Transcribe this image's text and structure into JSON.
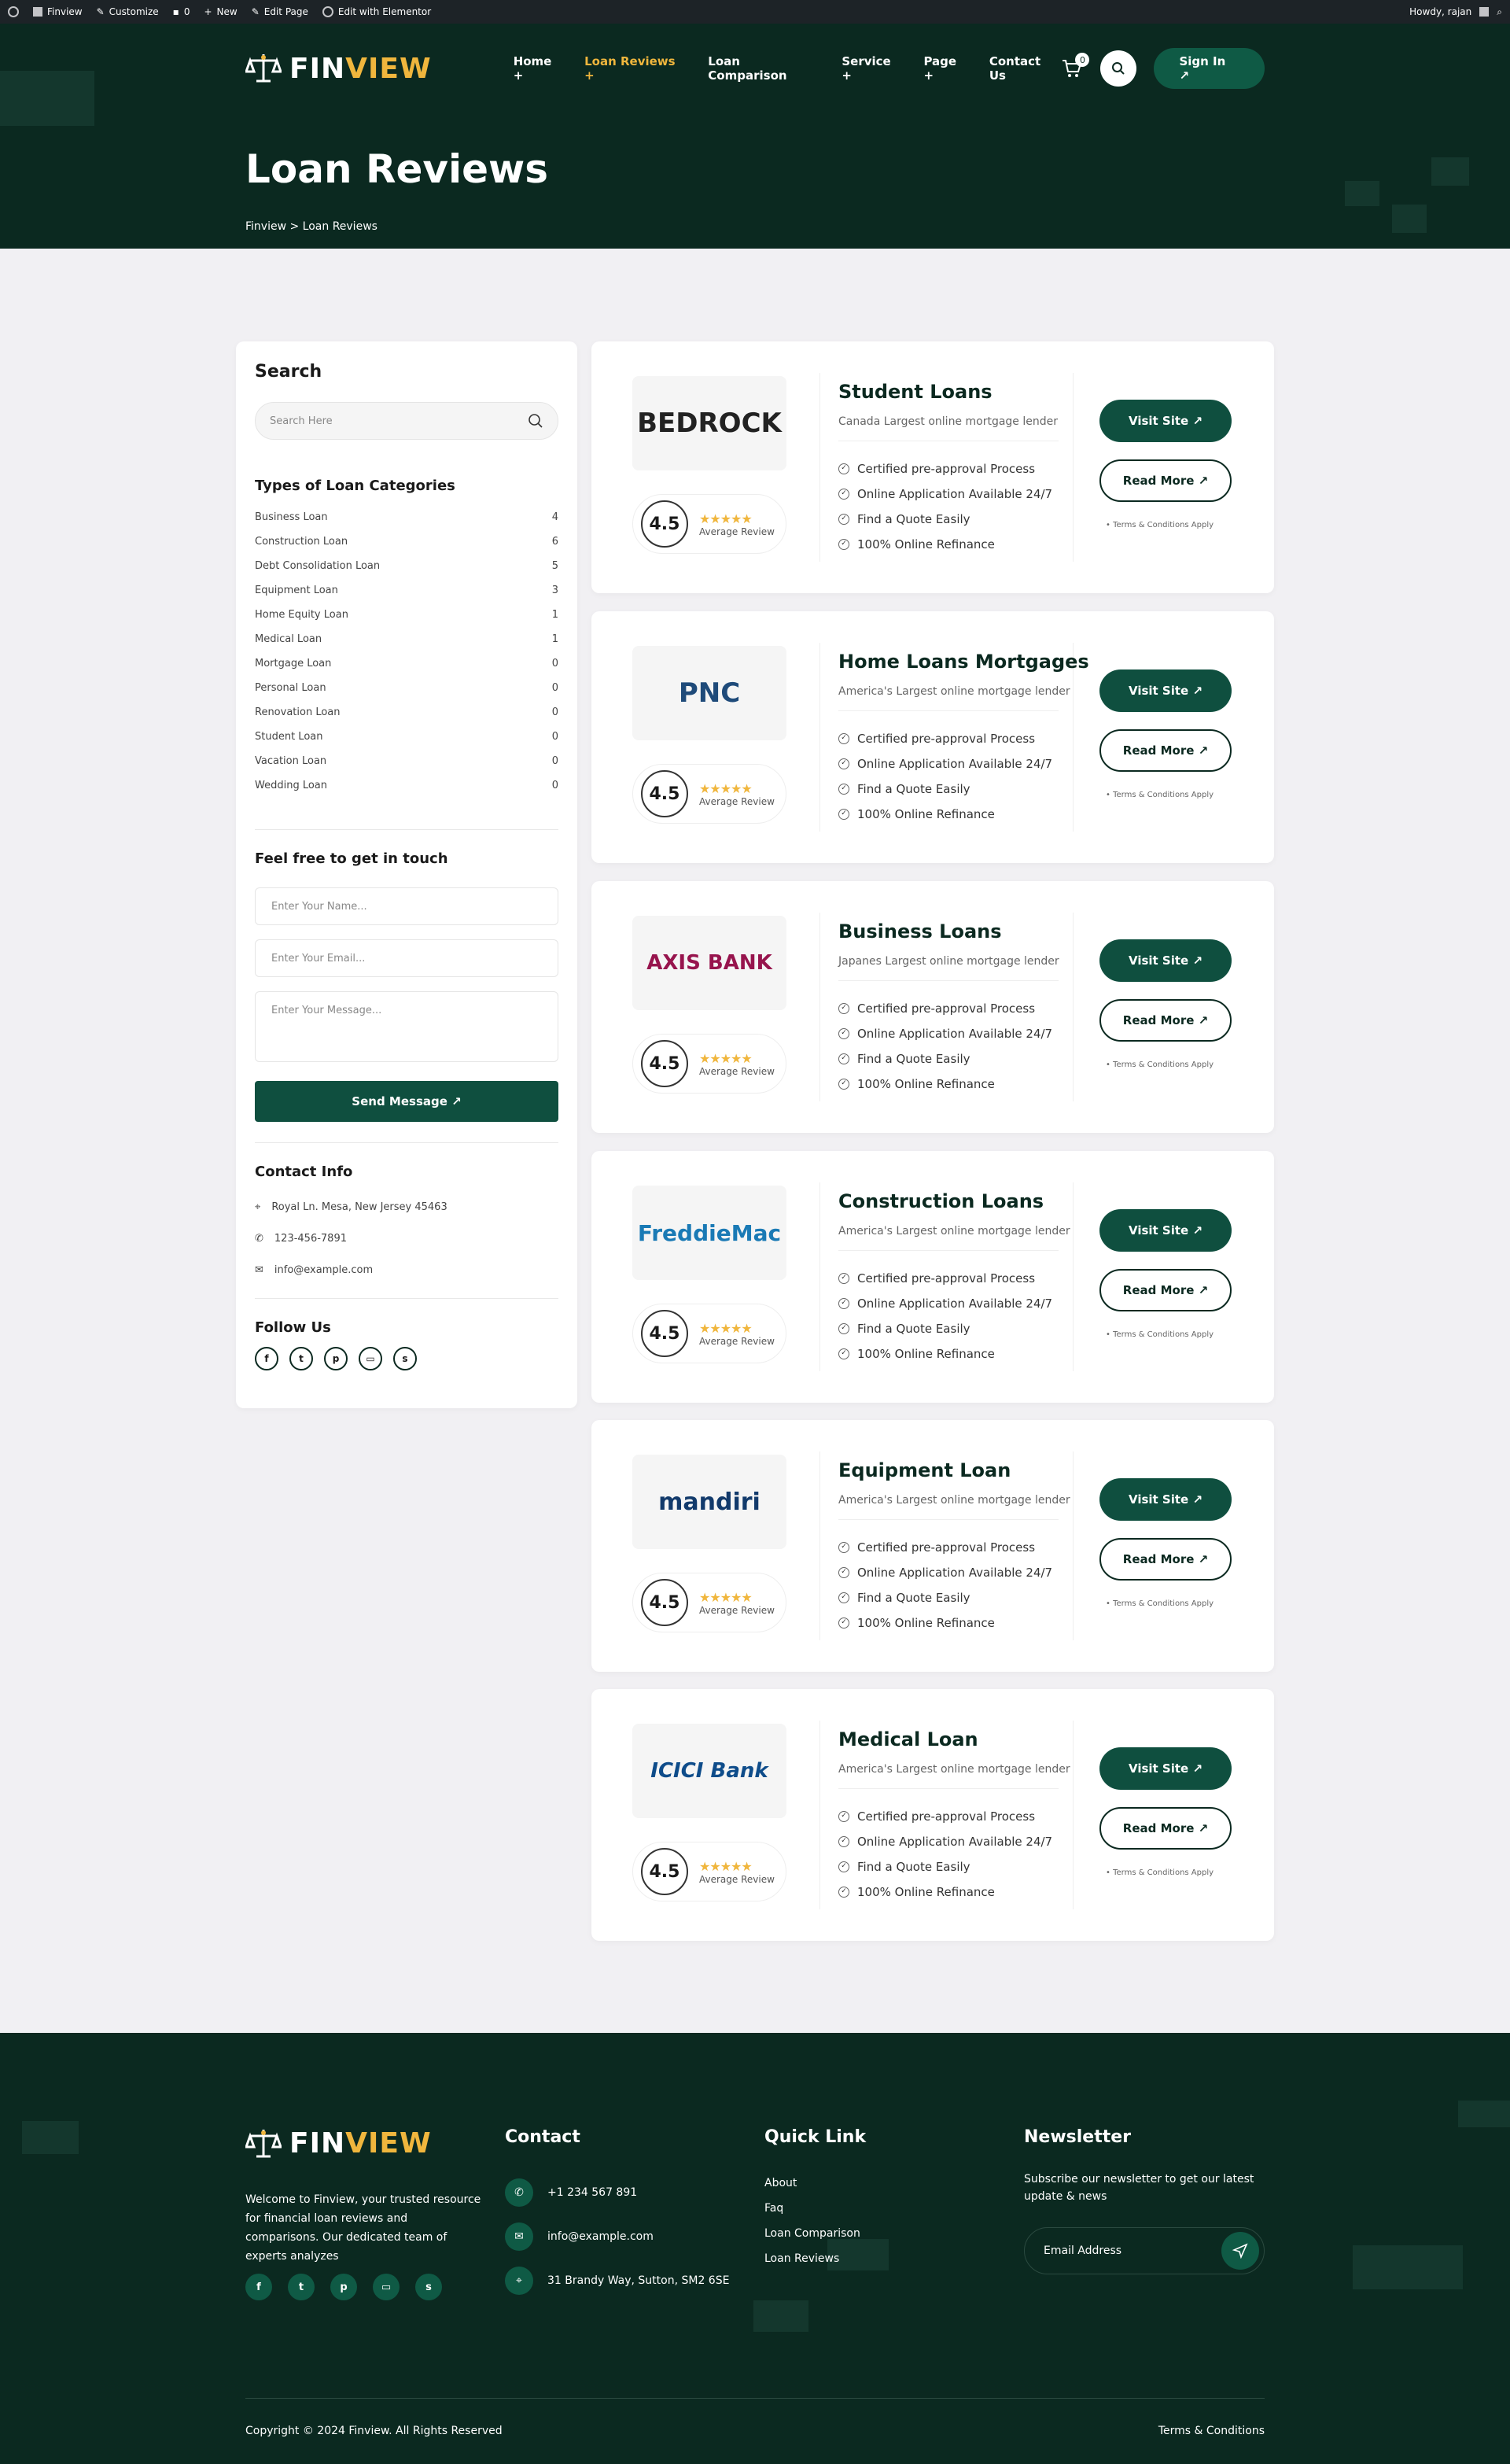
{
  "adminbar": {
    "site": "Finview",
    "customize": "Customize",
    "comments": "0",
    "new": "New",
    "edit_page": "Edit Page",
    "edit_elementor": "Edit with Elementor",
    "howdy": "Howdy, rajan"
  },
  "brand": {
    "name_a": "FIN",
    "name_b": "VIEW"
  },
  "nav": {
    "items": [
      "Home +",
      "Loan Reviews +",
      "Loan Comparison",
      "Service +",
      "Page +",
      "Contact Us"
    ],
    "cart_count": "0",
    "signin": "Sign In ↗"
  },
  "hero": {
    "title": "Loan Reviews",
    "crumb": "Finview  >  Loan Reviews"
  },
  "sidebar": {
    "search_title": "Search",
    "search_placeholder": "Search Here",
    "cat_title": "Types of Loan Categories",
    "categories": [
      {
        "name": "Business Loan",
        "count": "4"
      },
      {
        "name": "Construction Loan",
        "count": "6"
      },
      {
        "name": "Debt Consolidation Loan",
        "count": "5"
      },
      {
        "name": "Equipment Loan",
        "count": "3"
      },
      {
        "name": "Home Equity Loan",
        "count": "1"
      },
      {
        "name": "Medical Loan",
        "count": "1"
      },
      {
        "name": "Mortgage Loan",
        "count": "0"
      },
      {
        "name": "Personal Loan",
        "count": "0"
      },
      {
        "name": "Renovation Loan",
        "count": "0"
      },
      {
        "name": "Student Loan",
        "count": "0"
      },
      {
        "name": "Vacation Loan",
        "count": "0"
      },
      {
        "name": "Wedding Loan",
        "count": "0"
      }
    ],
    "touch_title": "Feel free to get in touch",
    "name_ph": "Enter Your Name...",
    "email_ph": "Enter Your Email...",
    "msg_ph": "Enter Your Message...",
    "send": "Send Message ↗",
    "contact_title": "Contact Info",
    "address": "Royal Ln. Mesa, New Jersey 45463",
    "phone": "123-456-7891",
    "email": "info@example.com",
    "follow_title": "Follow Us"
  },
  "cards": [
    {
      "logo": "BEDROCK",
      "logo_color": "#222",
      "title": "Student Loans",
      "sub": "Canada Largest online mortgage lender"
    },
    {
      "logo": "PNC",
      "logo_color": "#1f4b7a",
      "title": "Home Loans Mortgages",
      "sub": "America's Largest online mortgage lender"
    },
    {
      "logo": "AXIS BANK",
      "logo_color": "#97144d",
      "title": "Business Loans",
      "sub": "Japanes Largest online mortgage lender"
    },
    {
      "logo": "FreddieMac",
      "logo_color": "#1a7ab5",
      "title": "Construction Loans",
      "sub": "America's Largest online mortgage lender"
    },
    {
      "logo": "mandiri",
      "logo_color": "#123a6b",
      "title": "Equipment Loan",
      "sub": "America's Largest online mortgage lender"
    },
    {
      "logo": "ICICI Bank",
      "logo_color": "#0e4c8a",
      "title": "Medical Loan",
      "sub": "America's Largest online mortgage lender"
    }
  ],
  "card_common": {
    "rating": "4.5",
    "stars": "★★★★★",
    "rating_label": "Average Review",
    "features": [
      "Certified pre-approval Process",
      "Online Application Available 24/7",
      "Find a Quote Easily",
      "100% Online Refinance"
    ],
    "visit": "Visit Site ↗",
    "read": "Read More ↗",
    "terms": "• Terms & Conditions Apply"
  },
  "footer": {
    "desc": "Welcome to Finview, your trusted resource for financial loan reviews and comparisons. Our dedicated team of experts analyzes",
    "contact_title": "Contact",
    "phone": "+1 234 567 891",
    "email": "info@example.com",
    "address": "31 Brandy Way, Sutton, SM2 6SE",
    "quick_title": "Quick Link",
    "links": [
      "About",
      "Faq",
      "Loan Comparison",
      "Loan Reviews"
    ],
    "news_title": "Newsletter",
    "news_text": "Subscribe our newsletter to get our latest update & news",
    "email_ph": "Email Address",
    "copyright": "Copyright © 2024 Finview. All Rights Reserved",
    "terms": "Terms & Conditions"
  }
}
